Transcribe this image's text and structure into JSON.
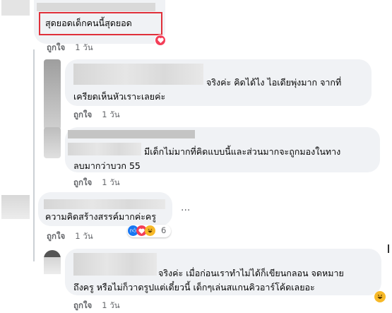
{
  "comments": [
    {
      "text": "สุดยอดเด็กคนนี้สุดยอด",
      "like_label": "ถูกใจ",
      "time": "1 วัน"
    },
    {
      "text_line1": "จริงค่ะ คิดได้ไง ไอเดียพุ่งมาก จากที่",
      "text_line2": "เครียดเห็นหัวเราะเลยค่ะ",
      "like_label": "ถูกใจ",
      "time": "1 วัน"
    },
    {
      "text_line1": "มีเด็กไม่มากที่คิดแบบนี้และส่วนมากจะถูกมองในทาง",
      "text_line2": "ลบมากว่าบวก 55",
      "like_label": "ถูกใจ",
      "time": "1 วัน"
    },
    {
      "text": "ความคิดสร้างสรรค์มากค่ะครู",
      "like_label": "ถูกใจ",
      "time": "1 วัน",
      "reaction_count": "6",
      "more": "···"
    },
    {
      "text_line1": "จริงค่ะ เมื่อก่อนเราทำไม่ได้ก็เขียนกลอน จดหมาย",
      "text_line2": "ถึงครู หรือไม่ก็วาดรูปแต่เดี๋ยวนี้ เด็กๆเล่นสแกนคิวอาร์โค้ดเลยอะ",
      "like_label": "ถูกใจ",
      "time": "1 วัน"
    }
  ],
  "colors": {
    "highlight": "#e0303a",
    "bubble": "#f0f2f5",
    "meta": "#65676b"
  },
  "icons": [
    "love-reaction-icon",
    "like-reaction-icon",
    "haha-reaction-icon"
  ]
}
